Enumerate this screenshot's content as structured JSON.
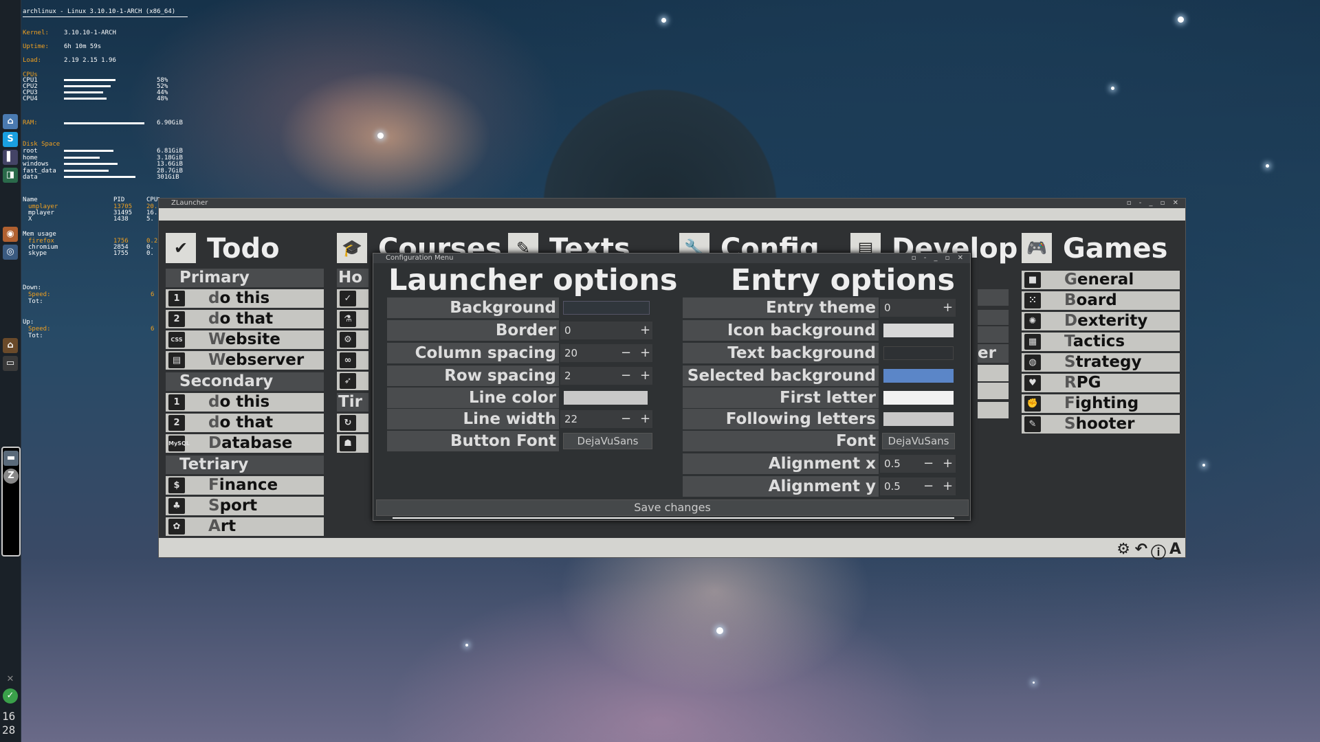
{
  "conky": {
    "header": "archlinux - Linux 3.10.10-1-ARCH (x86_64)",
    "kernel_label": "Kernel:",
    "kernel": "3.10.10-1-ARCH",
    "uptime_label": "Uptime:",
    "uptime": "6h 10m 59s",
    "load_label": "Load:",
    "load": "2.19 2.15 1.96",
    "cpus_label": "CPUs",
    "cpus": [
      {
        "name": "CPU1",
        "pct": "58%",
        "v": 0.58
      },
      {
        "name": "CPU2",
        "pct": "52%",
        "v": 0.52
      },
      {
        "name": "CPU3",
        "pct": "44%",
        "v": 0.44
      },
      {
        "name": "CPU4",
        "pct": "48%",
        "v": 0.48
      }
    ],
    "ram_label": "RAM:",
    "ram": "6.90GiB",
    "ram_v": 0.9,
    "disk_label": "Disk Space",
    "disks": [
      {
        "name": "root",
        "val": "6.81GiB",
        "v": 0.55
      },
      {
        "name": "home",
        "val": "3.18GiB",
        "v": 0.4
      },
      {
        "name": "windows",
        "val": "13.6GiB",
        "v": 0.6
      },
      {
        "name": "fast_data",
        "val": "28.7GiB",
        "v": 0.5
      },
      {
        "name": "data",
        "val": "301GiB",
        "v": 0.8
      }
    ],
    "proc_headers": [
      "Name",
      "PID",
      "CPU%"
    ],
    "procs": [
      {
        "name": "umplayer",
        "pid": "13705",
        "cpu": "20."
      },
      {
        "name": "mplayer",
        "pid": "31495",
        "cpu": "16."
      },
      {
        "name": "X",
        "pid": "1438",
        "cpu": "5."
      }
    ],
    "mem_label": "Mem usage",
    "mems": [
      {
        "name": "firefox",
        "pid": "1756",
        "cpu": "0.2"
      },
      {
        "name": "chromium",
        "pid": "2854",
        "cpu": "0."
      },
      {
        "name": "skype",
        "pid": "1755",
        "cpu": "0."
      }
    ],
    "down_label": "Down:",
    "speed_label": "Speed:",
    "tot_label": "Tot:",
    "up_label": "Up:",
    "speed_val": "6",
    "speed_val2": "6"
  },
  "clock": {
    "hour": "16",
    "minute": "28"
  },
  "launcher": {
    "title": "ZLauncher",
    "columns": [
      {
        "icon": "check-icon",
        "title": "Todo",
        "sections": [
          {
            "name": "Primary",
            "entries": [
              {
                "icon": "1",
                "first": "d",
                "rest": "o this"
              },
              {
                "icon": "2",
                "first": "d",
                "rest": "o that"
              },
              {
                "icon": "CSS",
                "first": "W",
                "rest": "ebsite"
              },
              {
                "icon": "▤",
                "first": "W",
                "rest": "ebserver"
              }
            ]
          },
          {
            "name": "Secondary",
            "entries": [
              {
                "icon": "1",
                "first": "d",
                "rest": "o this"
              },
              {
                "icon": "2",
                "first": "d",
                "rest": "o that"
              },
              {
                "icon": "MySQL",
                "first": "D",
                "rest": "atabase"
              }
            ]
          },
          {
            "name": "Tetriary",
            "entries": [
              {
                "icon": "$",
                "first": "F",
                "rest": "inance"
              },
              {
                "icon": "♣",
                "first": "S",
                "rest": "port"
              },
              {
                "icon": "✿",
                "first": "A",
                "rest": "rt"
              }
            ]
          }
        ]
      },
      {
        "icon": "graduation-cap-icon",
        "title": "Courses",
        "sections": [
          {
            "name": "Ho",
            "entries": [
              {
                "icon": "✓",
                "first": "",
                "rest": ""
              },
              {
                "icon": "⚗",
                "first": "",
                "rest": ""
              },
              {
                "icon": "⚙",
                "first": "",
                "rest": ""
              },
              {
                "icon": "∞",
                "first": "",
                "rest": ""
              },
              {
                "icon": "➶",
                "first": "",
                "rest": ""
              }
            ]
          },
          {
            "name": "Tir",
            "entries": [
              {
                "icon": "↻",
                "first": "",
                "rest": ""
              },
              {
                "icon": "☗",
                "first": "",
                "rest": ""
              }
            ]
          }
        ]
      },
      {
        "icon": "pencil-icon",
        "title": "Texts"
      },
      {
        "icon": "wrench-icon",
        "title": "Config"
      },
      {
        "icon": "terminal-icon",
        "title": "Develop",
        "partial": "er"
      },
      {
        "icon": "gamepad-icon",
        "title": "Games",
        "sections": [
          {
            "name": "",
            "entries": [
              {
                "icon": "■",
                "first": "G",
                "rest": "eneral"
              },
              {
                "icon": "⁙",
                "first": "B",
                "rest": "oard"
              },
              {
                "icon": "✺",
                "first": "D",
                "rest": "exterity"
              },
              {
                "icon": "▦",
                "first": "T",
                "rest": "actics"
              },
              {
                "icon": "◍",
                "first": "S",
                "rest": "trategy"
              },
              {
                "icon": "♥",
                "first": "R",
                "rest": "PG"
              },
              {
                "icon": "✊",
                "first": "F",
                "rest": "ighting"
              },
              {
                "icon": "✎",
                "first": "S",
                "rest": "hooter"
              }
            ]
          }
        ]
      }
    ]
  },
  "config": {
    "title": "Configuration Menu",
    "launcher_title": "Launcher options",
    "entry_title": "Entry options",
    "launcher_opts": {
      "background": "Background",
      "border": "Border",
      "border_val": "0",
      "column_spacing": "Column spacing",
      "column_spacing_val": "20",
      "row_spacing": "Row spacing",
      "row_spacing_val": "2",
      "line_color": "Line color",
      "line_width": "Line width",
      "line_width_val": "22",
      "button_font": "Button Font",
      "button_font_val": "DejaVuSans"
    },
    "entry_opts": {
      "entry_theme": "Entry theme",
      "entry_theme_val": "0",
      "icon_background": "Icon background",
      "text_background": "Text background",
      "selected_background": "Selected background",
      "first_letter": "First letter",
      "following_letters": "Following letters",
      "font": "Font",
      "font_val": "DejaVuSans",
      "alignment_x": "Alignment x",
      "alignment_x_val": "0.5",
      "alignment_y": "Alignment y",
      "alignment_y_val": "0.5"
    },
    "colors": {
      "background": "#30363c",
      "line_color": "#c8c8c8",
      "icon_background": "#d8d8d8",
      "text_background": "#2e3134",
      "selected_background": "#5b86c8",
      "first_letter": "#f2f2f2",
      "following_letters": "#c8c8c8"
    },
    "plus": "+",
    "minus": "−",
    "save": "Save changes"
  },
  "bottom_icons": [
    "gear-icon",
    "undo-icon",
    "info-icon",
    "font-icon"
  ]
}
